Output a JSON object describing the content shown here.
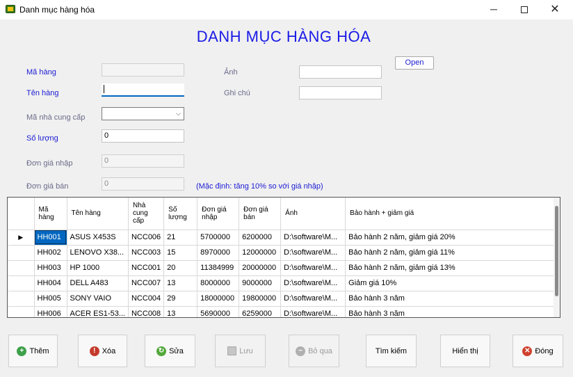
{
  "window": {
    "title": "Danh mục hàng hóa",
    "minimize": "─",
    "close": "✕"
  },
  "form": {
    "heading": "DANH MỤC HÀNG HÓA",
    "labels": {
      "ma_hang": "Mã hàng",
      "ten_hang": "Tên hàng",
      "ma_ncc": "Mã nhà cung cấp",
      "so_luong": "Số lượng",
      "don_gia_nhap": "Đơn giá nhập",
      "don_gia_ban": "Đơn giá bán",
      "anh": "Ảnh",
      "ghi_chu": "Ghi chú"
    },
    "values": {
      "ma_hang": "",
      "ten_hang": "",
      "ma_ncc": "",
      "so_luong": "0",
      "don_gia_nhap": "0",
      "don_gia_ban": "0",
      "anh": "",
      "ghi_chu": ""
    },
    "open_button": "Open",
    "hint": "(Mặc định: tăng 10% so với giá nhập)"
  },
  "grid": {
    "columns": [
      "Mã hàng",
      "Tên hàng",
      "Nhà cung cấp",
      "Số lượng",
      "Đơn giá nhập",
      "Đơn giá bán",
      "Ảnh",
      "Bảo hành + giảm giá"
    ],
    "current_row_marker": "▶",
    "rows": [
      [
        "HH001",
        "ASUS X453S",
        "NCC006",
        "21",
        "5700000",
        "6200000",
        "D:\\software\\M...",
        "Bảo hành 2 năm, giảm giá 20%"
      ],
      [
        "HH002",
        "LENOVO X38...",
        "NCC003",
        "15",
        "8970000",
        "12000000",
        "D:\\software\\M...",
        "Bảo hành 2 năm, giảm giá 11%"
      ],
      [
        "HH003",
        "HP 1000",
        "NCC001",
        "20",
        "11384999",
        "20000000",
        "D:\\software\\M...",
        "Bảo hành 2 năm, giảm giá 13%"
      ],
      [
        "HH004",
        "DELL A483",
        "NCC007",
        "13",
        "8000000",
        "9000000",
        "D:\\software\\M...",
        "Giảm giá 10%"
      ],
      [
        "HH005",
        "SONY VAIO",
        "NCC004",
        "29",
        "18000000",
        "19800000",
        "D:\\software\\M...",
        "Bảo hành 3 năm"
      ],
      [
        "HH006",
        "ACER ES1-53...",
        "NCC008",
        "13",
        "5690000",
        "6259000",
        "D:\\software\\M...",
        "Bảo hành 3 năm"
      ]
    ]
  },
  "buttons": {
    "them": "Thêm",
    "xoa": "Xóa",
    "sua": "Sửa",
    "luu": "Lưu",
    "bo_qua": "Bỏ qua",
    "tim_kiem": "Tìm kiếm",
    "hien_thi": "Hiển thị",
    "dong": "Đóng"
  }
}
